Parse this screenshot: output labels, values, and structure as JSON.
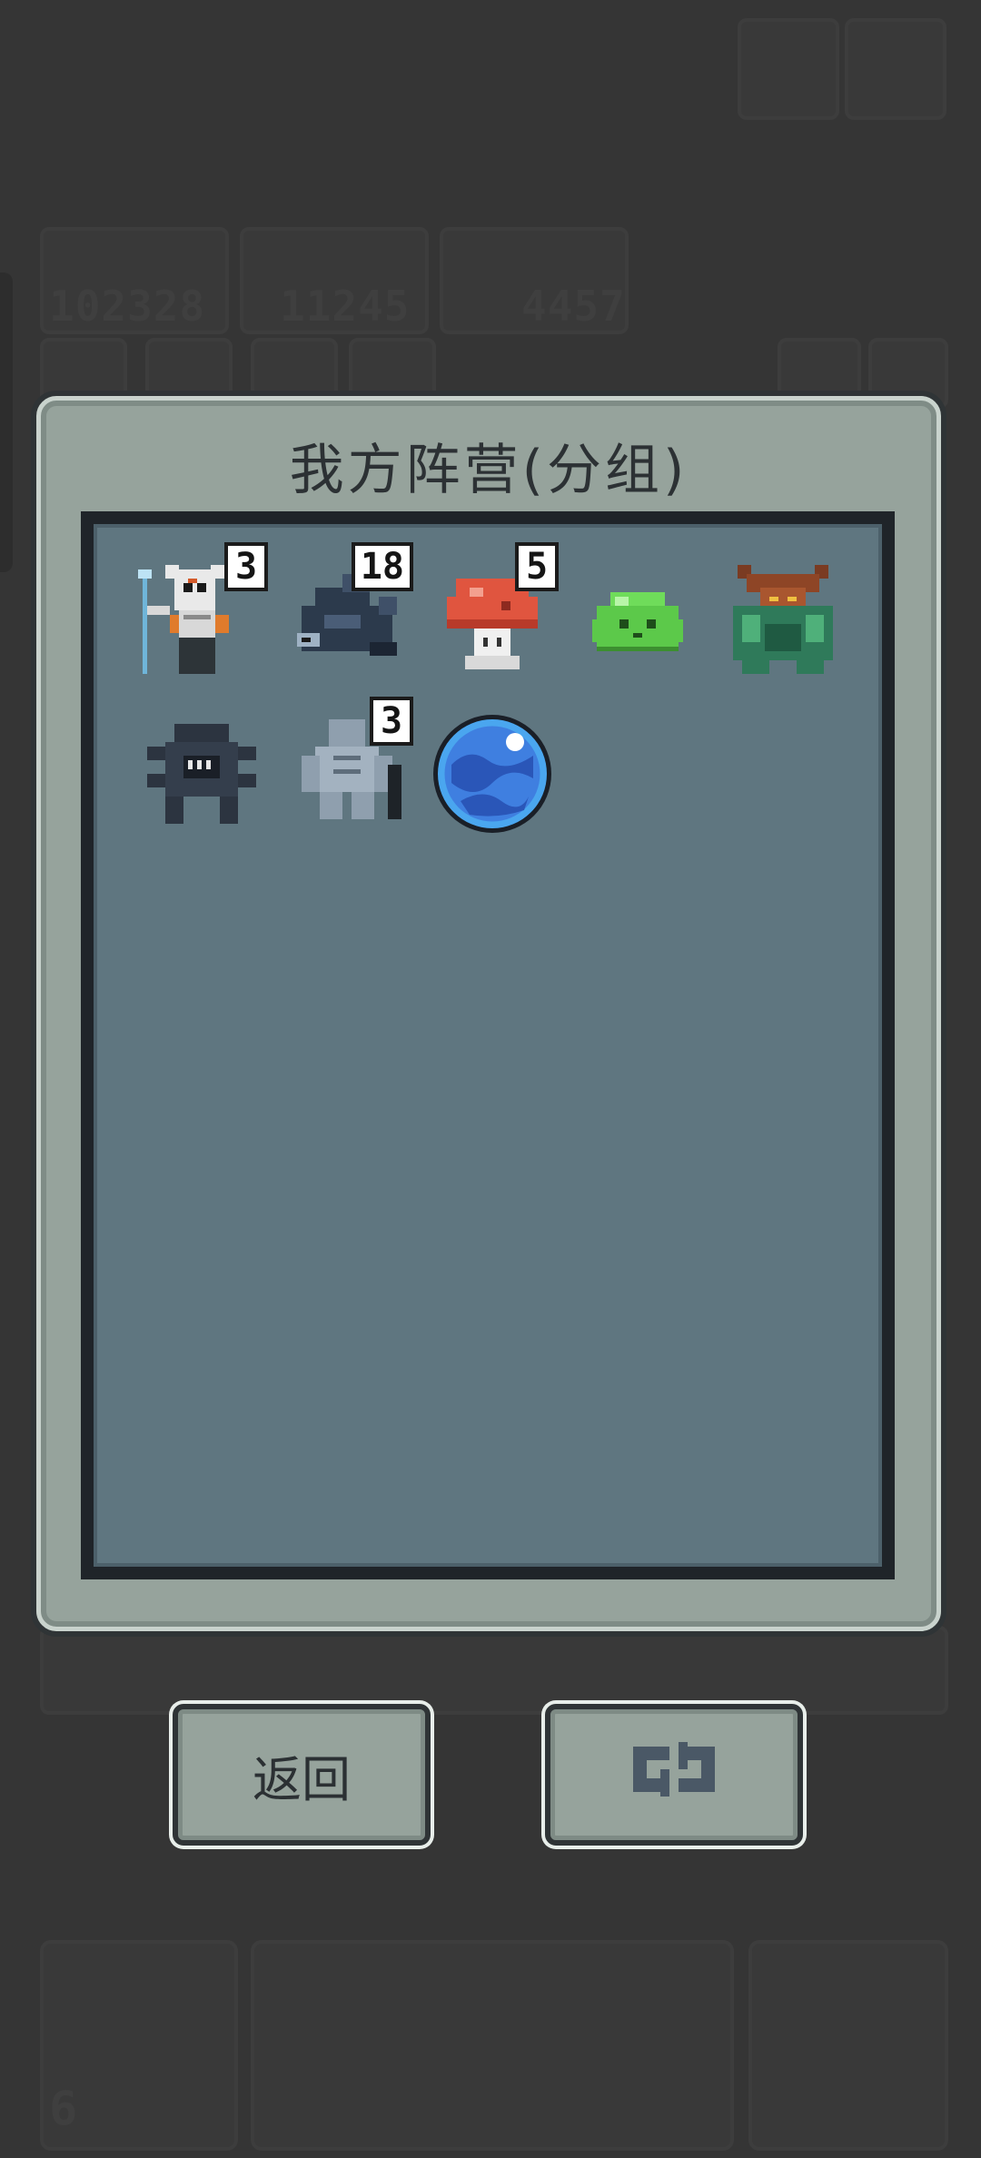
{
  "background": {
    "resource_counts": [
      "102328",
      "11245",
      "4457"
    ],
    "bottom_left_count": "6"
  },
  "dialog": {
    "title": "我方阵营(分组)"
  },
  "units": [
    {
      "name": "skeleton-shaman",
      "count": "3"
    },
    {
      "name": "shadow-fish",
      "count": "18"
    },
    {
      "name": "red-mushroom",
      "count": "5"
    },
    {
      "name": "green-slime",
      "count": ""
    },
    {
      "name": "horned-minotaur",
      "count": ""
    },
    {
      "name": "dark-spider-crab",
      "count": ""
    },
    {
      "name": "stone-golem",
      "count": "3"
    },
    {
      "name": "blue-orb",
      "count": ""
    }
  ],
  "buttons": {
    "back_label": "返回",
    "swap_icon": "swap-arrows-icon"
  },
  "colors": {
    "panel": "#96a39c",
    "inner": "#5f7680",
    "background": "#353535"
  }
}
